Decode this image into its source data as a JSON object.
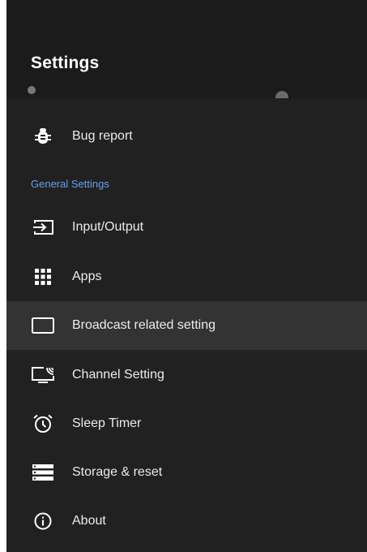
{
  "header": {
    "title": "Settings"
  },
  "items_top": [
    {
      "label": "Bug report",
      "icon": "bug-icon"
    }
  ],
  "section": {
    "label": "General Settings"
  },
  "items": [
    {
      "label": "Input/Output",
      "icon": "input-icon"
    },
    {
      "label": "Apps",
      "icon": "apps-grid-icon"
    },
    {
      "label": "Broadcast related setting",
      "icon": "tv-icon"
    },
    {
      "label": "Channel Setting",
      "icon": "cast-tv-icon"
    },
    {
      "label": "Sleep Timer",
      "icon": "alarm-icon"
    },
    {
      "label": "Storage & reset",
      "icon": "storage-icon"
    },
    {
      "label": "About",
      "icon": "info-icon"
    }
  ],
  "colors": {
    "background": "#212121",
    "header": "#1b1b1b",
    "selected_row": "#333333",
    "section_header": "#5fa2f0",
    "text": "#ececec"
  }
}
